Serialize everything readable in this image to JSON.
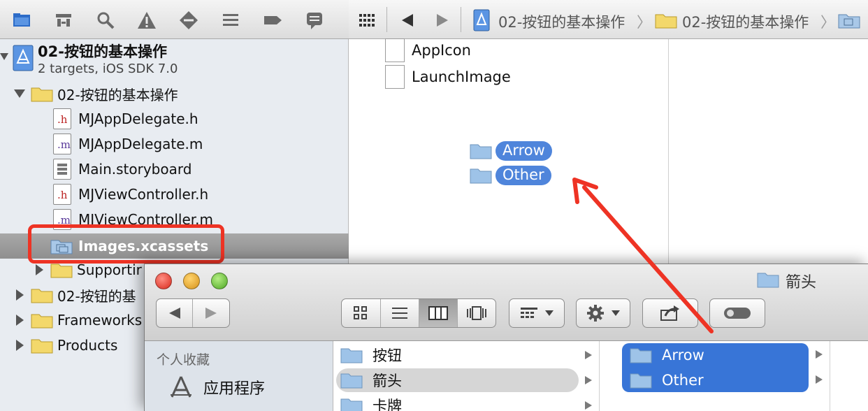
{
  "navigator": {
    "project_title": "02-按钮的基本操作",
    "project_subtitle": "2 targets, iOS SDK 7.0",
    "items": [
      {
        "label": "02-按钮的基本操作",
        "kind": "folder"
      },
      {
        "label": "MJAppDelegate.h",
        "kind": "h"
      },
      {
        "label": "MJAppDelegate.m",
        "kind": "m"
      },
      {
        "label": "Main.storyboard",
        "kind": "storyboard"
      },
      {
        "label": "MJViewController.h",
        "kind": "h"
      },
      {
        "label": "MJViewController.m",
        "kind": "m"
      },
      {
        "label": "Images.xcassets",
        "kind": "xcassets"
      },
      {
        "label": "Supportir",
        "kind": "folder"
      },
      {
        "label": "02-按钮的基",
        "kind": "folder"
      },
      {
        "label": "Frameworks",
        "kind": "folder"
      },
      {
        "label": "Products",
        "kind": "folder"
      }
    ]
  },
  "jumpbar": {
    "crumbs": [
      "02-按钮的基本操作",
      "02-按钮的基本操作"
    ]
  },
  "asset_catalog": {
    "items": [
      "AppIcon",
      "LaunchImage"
    ]
  },
  "drag": {
    "items": [
      "Arrow",
      "Other"
    ]
  },
  "finder": {
    "title": "箭头",
    "sidebar": {
      "section": "个人收藏",
      "items": [
        "应用程序"
      ]
    },
    "column1": [
      "按钮",
      "箭头",
      "卡牌"
    ],
    "column3": [
      "Arrow",
      "Other"
    ]
  },
  "colors": {
    "annotation_red": "#ee3324",
    "selection_blue": "#3875d7",
    "folder_blue": "#9ec3e8",
    "folder_yellow": "#f3d86b"
  }
}
